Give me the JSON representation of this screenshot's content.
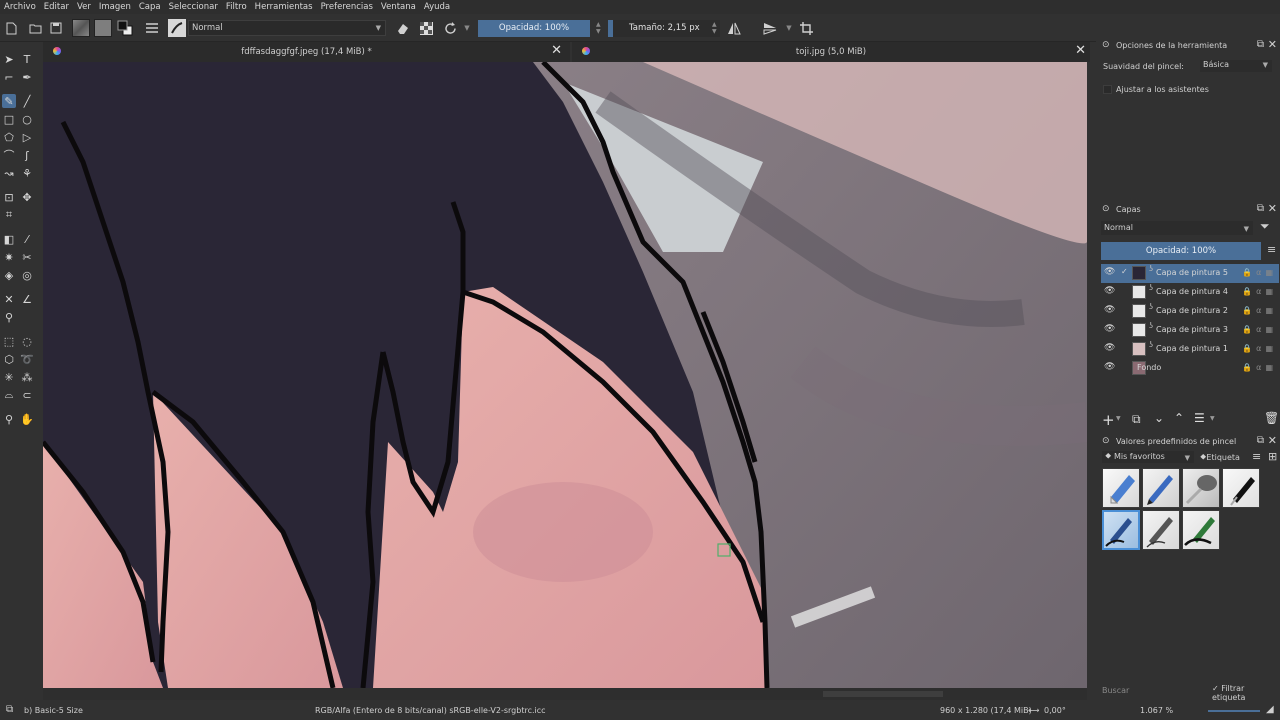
{
  "menu": [
    "Archivo",
    "Editar",
    "Ver",
    "Imagen",
    "Capa",
    "Seleccionar",
    "Filtro",
    "Herramientas",
    "Preferencias",
    "Ventana",
    "Ayuda"
  ],
  "toolbar": {
    "blend_mode": "Normal",
    "opacity": "Opacidad: 100%",
    "size": "Tamaño: 2,15 px"
  },
  "tabs": [
    {
      "title": "fdffasdaggfgf.jpeg (17,4 MiB) *",
      "close": "✕"
    },
    {
      "title": "toji.jpg (5,0 MiB)",
      "close": "✕"
    }
  ],
  "tool_options": {
    "title": "Opciones de la herramienta",
    "smoothing_label": "Suavidad del pincel:",
    "smoothing_value": "Básica",
    "assistants_label": "Ajustar a los asistentes"
  },
  "layers": {
    "title": "Capas",
    "blend_mode": "Normal",
    "opacity": "Opacidad:  100%",
    "items": [
      {
        "name": "Capa de pintura 5",
        "selected": true
      },
      {
        "name": "Capa de pintura 4",
        "selected": false
      },
      {
        "name": "Capa de pintura 2",
        "selected": false
      },
      {
        "name": "Capa de pintura 3",
        "selected": false
      },
      {
        "name": "Capa de pintura 1",
        "selected": false
      },
      {
        "name": "Fondo",
        "selected": false
      }
    ]
  },
  "presets": {
    "title": "Valores predefinidos de pincel",
    "tag": "Mis favoritos",
    "tag_button": "Etiqueta",
    "search_placeholder": "Buscar",
    "filter_label": "Filtrar etiqueta"
  },
  "status": {
    "brush": "b) Basic-5 Size",
    "color_info": "RGB/Alfa (Entero de 8 bits/canal)  sRGB-elle-V2-srgbtrc.icc",
    "dimensions": "960 x 1.280 (17,4 MiB)",
    "rotation": "0,00°",
    "zoom": "1.067 %"
  },
  "colors": {
    "accent": "#4a6f98",
    "dark_hair": "#2a2636",
    "skin": "#e2a6a8",
    "background": "#313131"
  }
}
